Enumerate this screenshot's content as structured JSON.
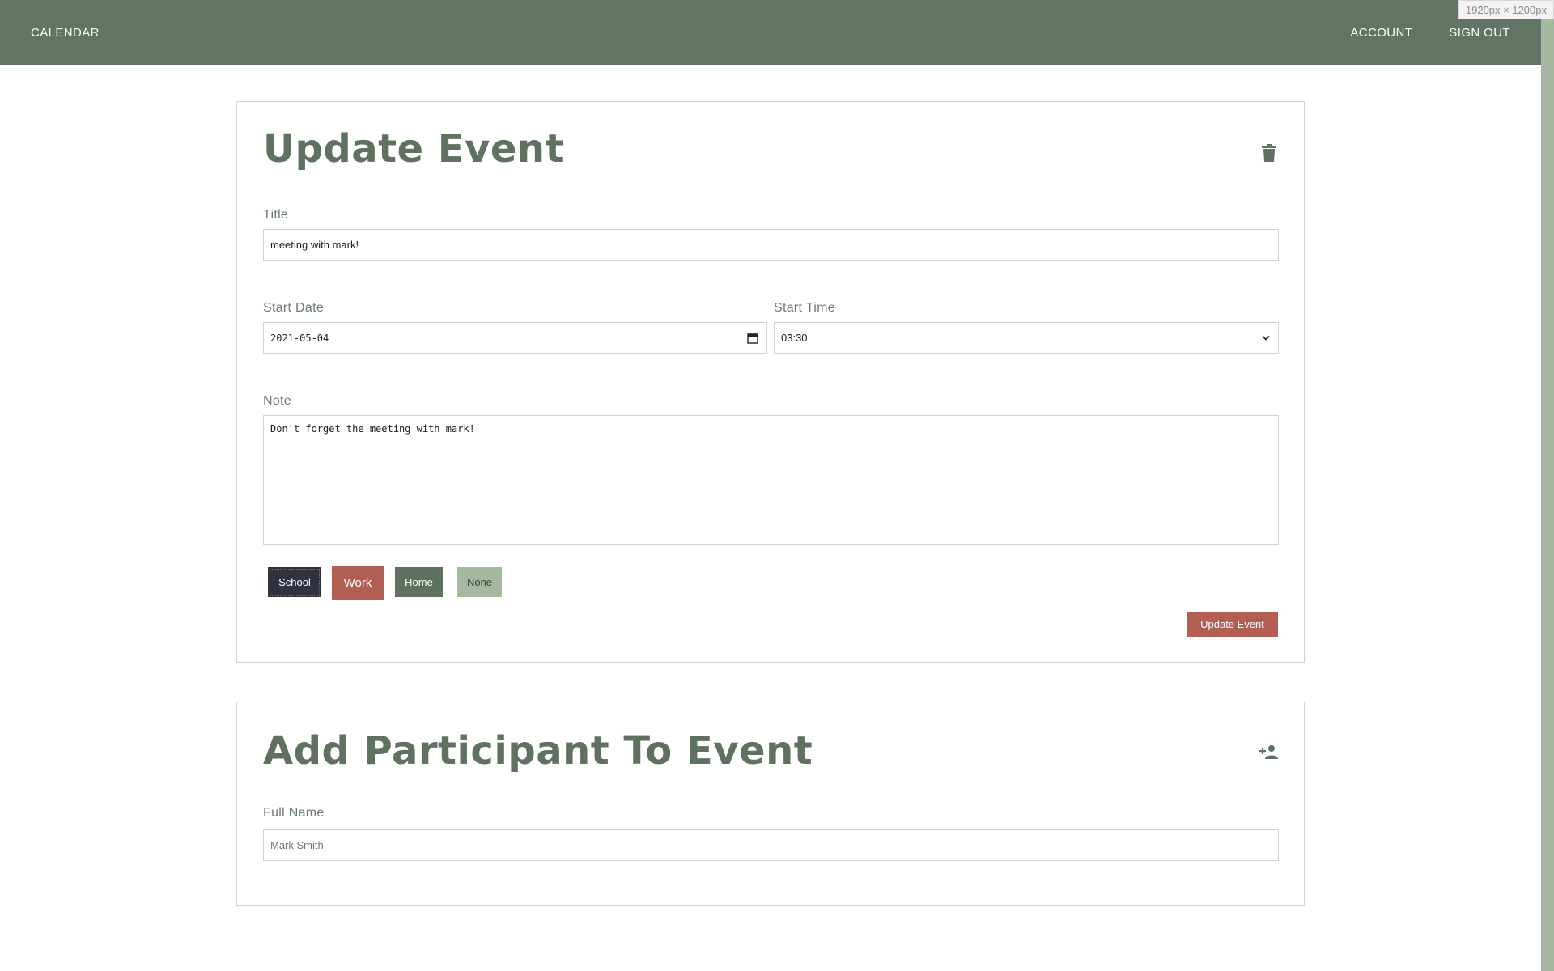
{
  "nav": {
    "brand": "CALENDAR",
    "account": "ACCOUNT",
    "sign_out": "SIGN OUT"
  },
  "viewport_label": "1920px × 1200px",
  "update_event": {
    "title": "Update Event",
    "delete_icon": "trash-icon",
    "title_label": "Title",
    "title_value": "meeting with mark!",
    "start_date_label": "Start Date",
    "start_date_value": "2021-05-04",
    "start_time_label": "Start Time",
    "start_time_value": "03:30",
    "note_label": "Note",
    "note_value": "Don't forget the meeting with mark!",
    "tags": [
      {
        "label": "School",
        "color": "#30323f"
      },
      {
        "label": "Work",
        "color": "#b15e53"
      },
      {
        "label": "Home",
        "color": "#5f7260"
      },
      {
        "label": "None",
        "color": "#a5b9a1"
      }
    ],
    "submit_label": "Update Event"
  },
  "add_participant": {
    "title": "Add Participant To Event",
    "icon": "person-add-icon",
    "full_name_label": "Full Name",
    "full_name_placeholder": "Mark Smith"
  },
  "colors": {
    "nav_bg": "#627564",
    "accent_green": "#5f7260",
    "accent_red": "#b15e53",
    "scrollbar": "#a5b9a1"
  }
}
